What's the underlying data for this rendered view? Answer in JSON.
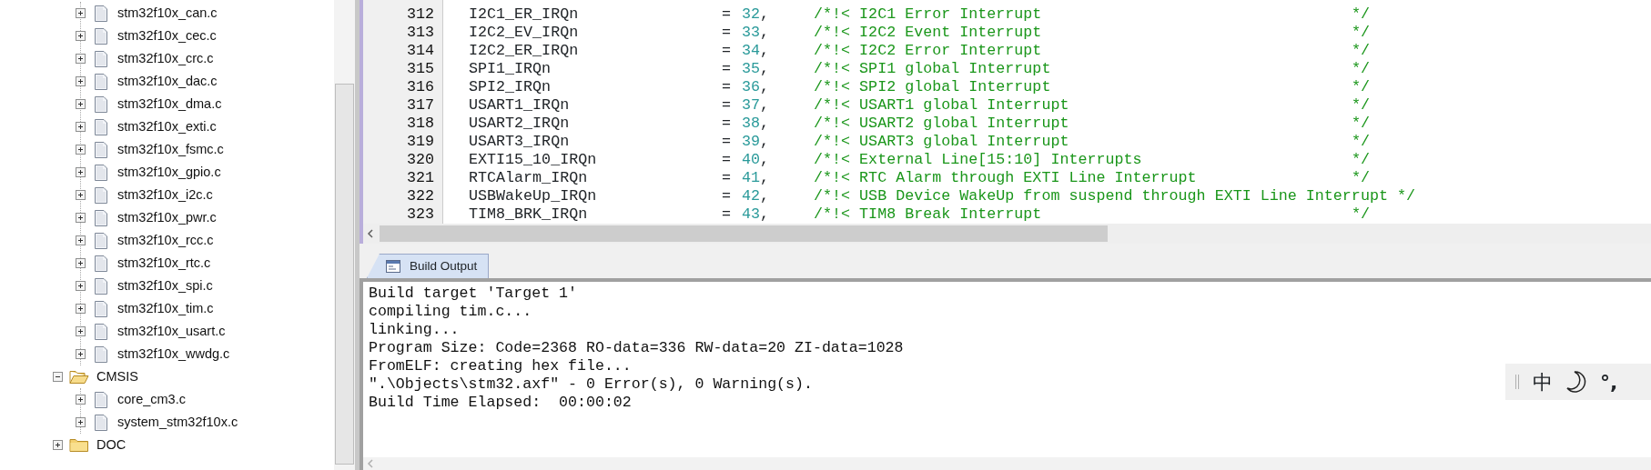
{
  "project_tree": [
    {
      "children": [
        {
          "label": "stm32f10x_can.c",
          "kind": "file",
          "expanded": false
        },
        {
          "label": "stm32f10x_cec.c",
          "kind": "file",
          "expanded": false
        },
        {
          "label": "stm32f10x_crc.c",
          "kind": "file",
          "expanded": false
        },
        {
          "label": "stm32f10x_dac.c",
          "kind": "file",
          "expanded": false
        },
        {
          "label": "stm32f10x_dma.c",
          "kind": "file",
          "expanded": false
        },
        {
          "label": "stm32f10x_exti.c",
          "kind": "file",
          "expanded": false
        },
        {
          "label": "stm32f10x_fsmc.c",
          "kind": "file",
          "expanded": false
        },
        {
          "label": "stm32f10x_gpio.c",
          "kind": "file",
          "expanded": false
        },
        {
          "label": "stm32f10x_i2c.c",
          "kind": "file",
          "expanded": false
        },
        {
          "label": "stm32f10x_pwr.c",
          "kind": "file",
          "expanded": false
        },
        {
          "label": "stm32f10x_rcc.c",
          "kind": "file",
          "expanded": false
        },
        {
          "label": "stm32f10x_rtc.c",
          "kind": "file",
          "expanded": false
        },
        {
          "label": "stm32f10x_spi.c",
          "kind": "file",
          "expanded": false
        },
        {
          "label": "stm32f10x_tim.c",
          "kind": "file",
          "expanded": false
        },
        {
          "label": "stm32f10x_usart.c",
          "kind": "file",
          "expanded": false
        },
        {
          "label": "stm32f10x_wwdg.c",
          "kind": "file",
          "expanded": false
        }
      ]
    },
    {
      "label": "CMSIS",
      "kind": "folder",
      "expanded": true,
      "children": [
        {
          "label": "core_cm3.c",
          "kind": "file",
          "expanded": false
        },
        {
          "label": "system_stm32f10x.c",
          "kind": "file",
          "expanded": false
        }
      ]
    },
    {
      "label": "DOC",
      "kind": "folder",
      "expanded": false
    }
  ],
  "editor": {
    "lines": [
      {
        "number": "312",
        "name": "I2C1_ER_IRQn",
        "op": "=",
        "value": "32",
        "punct": ",",
        "comment": "/*!< I2C1 Error Interrupt",
        "close": "*/"
      },
      {
        "number": "313",
        "name": "I2C2_EV_IRQn",
        "op": "=",
        "value": "33",
        "punct": ",",
        "comment": "/*!< I2C2 Event Interrupt",
        "close": "*/"
      },
      {
        "number": "314",
        "name": "I2C2_ER_IRQn",
        "op": "=",
        "value": "34",
        "punct": ",",
        "comment": "/*!< I2C2 Error Interrupt",
        "close": "*/"
      },
      {
        "number": "315",
        "name": "SPI1_IRQn",
        "op": "=",
        "value": "35",
        "punct": ",",
        "comment": "/*!< SPI1 global Interrupt",
        "close": "*/"
      },
      {
        "number": "316",
        "name": "SPI2_IRQn",
        "op": "=",
        "value": "36",
        "punct": ",",
        "comment": "/*!< SPI2 global Interrupt",
        "close": "*/"
      },
      {
        "number": "317",
        "name": "USART1_IRQn",
        "op": "=",
        "value": "37",
        "punct": ",",
        "comment": "/*!< USART1 global Interrupt",
        "close": "*/"
      },
      {
        "number": "318",
        "name": "USART2_IRQn",
        "op": "=",
        "value": "38",
        "punct": ",",
        "comment": "/*!< USART2 global Interrupt",
        "close": "*/"
      },
      {
        "number": "319",
        "name": "USART3_IRQn",
        "op": "=",
        "value": "39",
        "punct": ",",
        "comment": "/*!< USART3 global Interrupt",
        "close": "*/"
      },
      {
        "number": "320",
        "name": "EXTI15_10_IRQn",
        "op": "=",
        "value": "40",
        "punct": ",",
        "comment": "/*!< External Line[15:10] Interrupts",
        "close": "*/"
      },
      {
        "number": "321",
        "name": "RTCAlarm_IRQn",
        "op": "=",
        "value": "41",
        "punct": ",",
        "comment": "/*!< RTC Alarm through EXTI Line Interrupt",
        "close": "*/"
      },
      {
        "number": "322",
        "name": "USBWakeUp_IRQn",
        "op": "=",
        "value": "42",
        "punct": ",",
        "comment": "/*!< USB Device WakeUp from suspend through EXTI Line Interrupt",
        "close": "*/"
      },
      {
        "number": "323",
        "name": "TIM8_BRK_IRQn",
        "op": "=",
        "value": "43",
        "punct": ",",
        "comment": "/*!< TIM8 Break Interrupt",
        "close": "*/"
      }
    ]
  },
  "output_panel": {
    "tabs": [
      {
        "label": "Build Output",
        "selected": true
      }
    ],
    "lines": [
      "Build target 'Target 1'",
      "compiling tim.c...",
      "linking...",
      "Program Size: Code=2368 RO-data=336 RW-data=20 ZI-data=1028",
      "FromELF: creating hex file...",
      "\".\\Objects\\stm32.axf\" - 0 Error(s), 0 Warning(s).",
      "Build Time Elapsed:  00:00:02"
    ]
  },
  "ime_bar": {
    "language": "中",
    "punctuation": "°,"
  }
}
